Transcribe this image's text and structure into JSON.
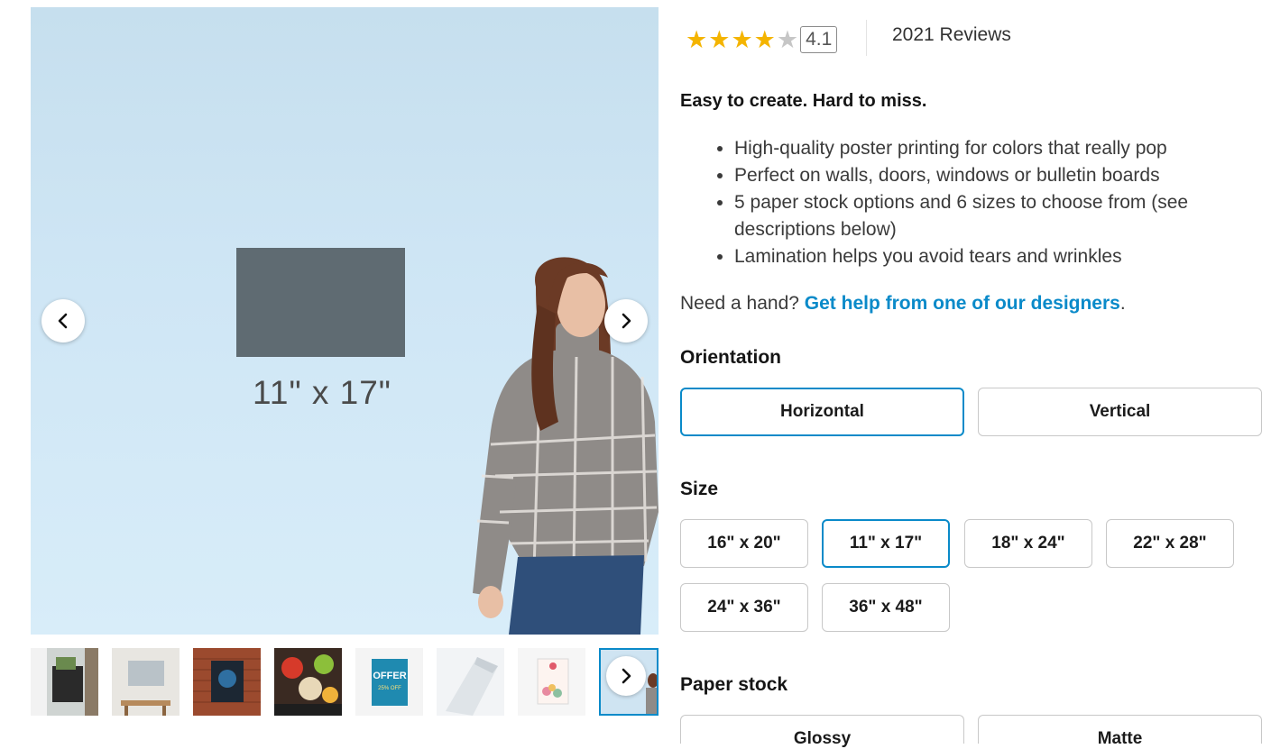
{
  "gallery": {
    "poster_size_label": "11\" x 17\"",
    "prev_icon": "chevron-left-icon",
    "next_icon": "chevron-right-icon",
    "thumbnails": [
      {
        "name": "thumbnail-storefront",
        "selected": false
      },
      {
        "name": "thumbnail-office-wall",
        "selected": false
      },
      {
        "name": "thumbnail-brick-wall",
        "selected": false
      },
      {
        "name": "thumbnail-food-poster",
        "selected": false
      },
      {
        "name": "thumbnail-offer-poster",
        "selected": false,
        "texts": {
          "top": "OFFER",
          "bottom": "25% OFF"
        }
      },
      {
        "name": "thumbnail-rolled-poster",
        "selected": false
      },
      {
        "name": "thumbnail-floral-poster",
        "selected": false
      },
      {
        "name": "thumbnail-current",
        "selected": true
      }
    ]
  },
  "rating": {
    "value": "4.1",
    "stars_filled": 4,
    "stars_total": 5,
    "reviews": "2021 Reviews"
  },
  "description": {
    "headline": "Easy to create. Hard to miss.",
    "bullets": [
      "High-quality poster printing for colors that really pop",
      "Perfect on walls, doors, windows or bulletin boards",
      "5 paper stock options and 6 sizes to choose from (see descriptions below)",
      "Lamination helps you avoid tears and wrinkles"
    ],
    "help_prefix": "Need a hand? ",
    "help_link": "Get help from one of our designers",
    "help_suffix": "."
  },
  "orientation": {
    "label": "Orientation",
    "options": [
      "Horizontal",
      "Vertical"
    ],
    "selected": "Horizontal"
  },
  "size": {
    "label": "Size",
    "options": [
      "16\" x 20\"",
      "11\" x 17\"",
      "18\" x 24\"",
      "22\" x 28\"",
      "24\" x 36\"",
      "36\" x 48\""
    ],
    "selected": "11\" x 17\""
  },
  "paper_stock": {
    "label": "Paper stock",
    "options": [
      "Glossy",
      "Matte"
    ]
  },
  "colors": {
    "accent": "#0a8ac9",
    "star": "#f4b400",
    "option_border": "#c8c8c8"
  }
}
